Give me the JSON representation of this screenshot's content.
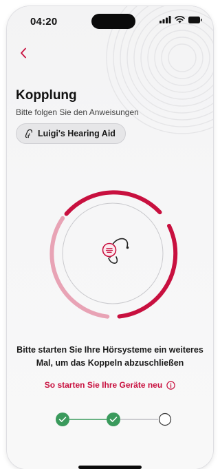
{
  "status_bar": {
    "time": "04:20",
    "icons": [
      "signal-icon",
      "wifi-icon",
      "battery-icon"
    ]
  },
  "nav": {
    "back_icon": "chevron-left-icon"
  },
  "header": {
    "title": "Kopplung",
    "subtitle": "Bitte folgen Sie den Anweisungen"
  },
  "device_chip": {
    "icon": "hearing-aid-icon",
    "label": "Luigi's Hearing Aid"
  },
  "pairing_visual": {
    "icon": "hearing-aid-icon"
  },
  "instruction": "Bitte starten Sie Ihre Hörsysteme ein weiteres Mal, um das Koppeln abzuschließen",
  "help_link": {
    "label": "So starten Sie Ihre Geräte neu",
    "icon": "info-icon"
  },
  "stepper": {
    "steps": [
      {
        "state": "completed",
        "icon": "check-icon"
      },
      {
        "state": "completed",
        "icon": "check-icon"
      },
      {
        "state": "pending"
      }
    ]
  },
  "colors": {
    "accent": "#c8103f",
    "accent_light": "#e8a3b5",
    "success": "#3a9a5c",
    "background": "#f4f4f5"
  }
}
